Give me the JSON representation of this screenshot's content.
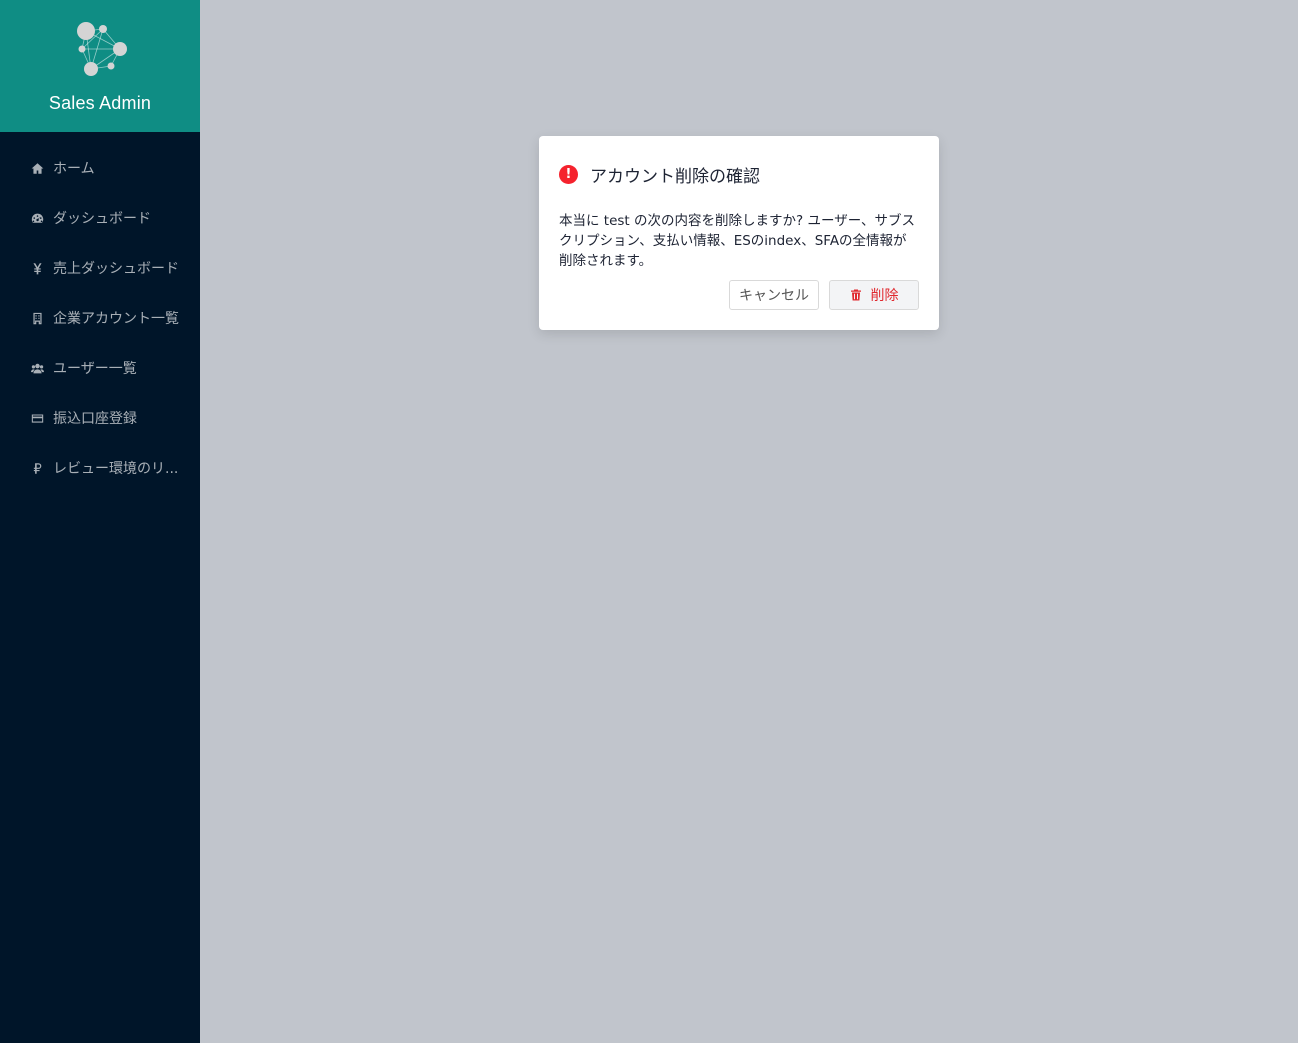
{
  "app": {
    "title": "Sales Admin",
    "brand_color": "#0f8d84",
    "sidebar_color": "#001529"
  },
  "sidebar": {
    "items": [
      {
        "label": "ホーム",
        "icon": "home-icon"
      },
      {
        "label": "ダッシュボード",
        "icon": "dashboard-icon"
      },
      {
        "label": "売上ダッシュボード",
        "icon": "yen-icon"
      },
      {
        "label": "企業アカウント一覧",
        "icon": "building-icon"
      },
      {
        "label": "ユーザー一覧",
        "icon": "users-icon"
      },
      {
        "label": "振込口座登録",
        "icon": "credit-card-icon"
      },
      {
        "label": "レビュー環境のリ...",
        "icon": "ruble-icon"
      }
    ]
  },
  "modal": {
    "title": "アカウント削除の確認",
    "message": "本当に test の次の内容を削除しますか? ユーザー、サブスクリプション、支払い情報、ESのindex、SFAの全情報が削除されます。",
    "cancel_label": "キャンセル",
    "delete_label": "削除",
    "warning_color": "#f5222d"
  }
}
